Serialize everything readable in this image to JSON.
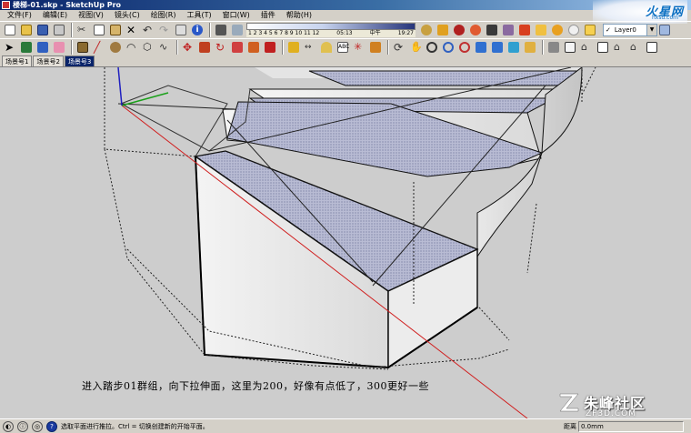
{
  "window": {
    "title": "楼梯-01.skp - SketchUp Pro"
  },
  "corner_logo": {
    "name": "火星网",
    "url": "hxsd.com"
  },
  "menu": [
    {
      "label": "文件(F)"
    },
    {
      "label": "编辑(E)"
    },
    {
      "label": "视图(V)"
    },
    {
      "label": "镜头(C)"
    },
    {
      "label": "绘图(R)"
    },
    {
      "label": "工具(T)"
    },
    {
      "label": "窗口(W)"
    },
    {
      "label": "插件"
    },
    {
      "label": "帮助(H)"
    }
  ],
  "shadow": {
    "months": "1 2 3 4 5 6 7 8 9 10 11 12",
    "left_time": "05:13",
    "midday": "中午",
    "right_time": "19:27"
  },
  "layer": {
    "check": "✓",
    "name": "Layer0"
  },
  "scenes": [
    {
      "label": "场景号1"
    },
    {
      "label": "场景号2"
    },
    {
      "label": "场景号3",
      "active": true
    }
  ],
  "caption": "进入踏步01群组，向下拉伸面，这里为200，好像有点低了，300更好一些",
  "watermark": {
    "name": "朱峰社区",
    "url": "ZF3D.COM"
  },
  "status": {
    "text": "选取平面进行推拉。Ctrl = 切换创建新的开始平面。",
    "measure_label": "距离",
    "measure_value": "0.0mm"
  },
  "colors": {
    "viewport_bg": "#cdcdcd",
    "face_pattern": "#aeb3cc",
    "edge": "#111111",
    "axis_red": "#d02020",
    "axis_green": "#1aa01a",
    "axis_blue": "#2020c0",
    "title_bar": "#0a246a"
  },
  "toolbar1_icons": [
    "new-icon",
    "open-icon",
    "save-icon",
    "print-icon",
    "cut-icon",
    "copy-icon",
    "paste-icon",
    "erase-icon",
    "undo-icon",
    "redo-icon",
    "print2-icon",
    "info-icon",
    "shadow-toggle-icon",
    "fog-icon",
    "shadow-settings-icon",
    "google-earth-icon",
    "get-model-icon",
    "share-icon",
    "component-icon",
    "model-info-icon",
    "face-style-icon",
    "axes-icon",
    "dimension-icon",
    "section-icon",
    "materials-icon",
    "x-ray-icon",
    "section-plane-icon",
    "layer-icon",
    "house-icon",
    "layers-manager-icon"
  ],
  "toolbar2_icons": [
    "select-icon",
    "make-component-icon",
    "paint-bucket-icon",
    "eraser-icon",
    "rectangle-icon",
    "line-icon",
    "circle-icon",
    "arc-icon",
    "polygon-icon",
    "freehand-icon",
    "move-icon",
    "push-pull-icon",
    "rotate-icon",
    "follow-me-icon",
    "scale-icon",
    "offset-icon",
    "tape-measure-icon",
    "dimension-tool-icon",
    "protractor-icon",
    "text-icon",
    "axes-tool-icon",
    "3d-text-icon",
    "orbit-icon",
    "pan-icon",
    "zoom-icon",
    "zoom-window-icon",
    "zoom-extents-icon",
    "previous-view-icon",
    "next-view-icon",
    "position-camera-icon",
    "walk-icon",
    "look-around-icon",
    "section-plane-tool-icon",
    "sandbox-icon",
    "iso-view-icon",
    "top-view-icon",
    "front-view-icon",
    "right-view-icon",
    "back-view-icon",
    "left-view-icon"
  ]
}
